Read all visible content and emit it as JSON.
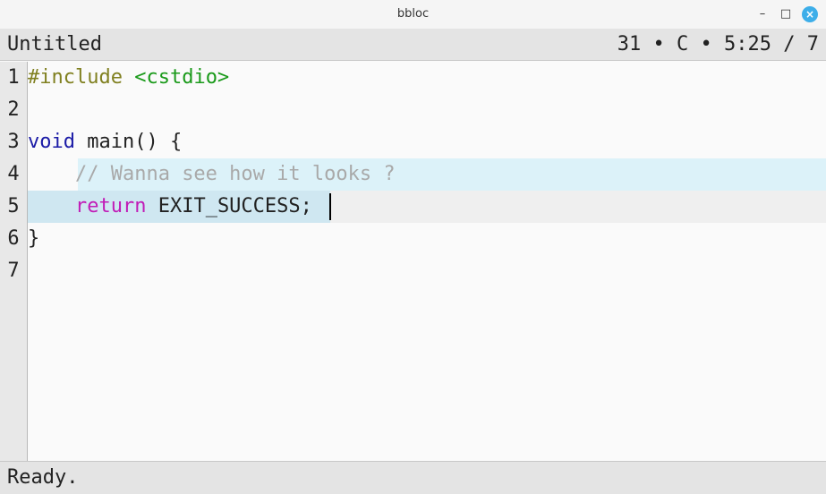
{
  "window": {
    "title": "bbloc",
    "minimize_glyph": "–",
    "maximize_glyph": "□",
    "close_glyph": "×"
  },
  "header": {
    "document_name": "Untitled",
    "info": {
      "char_count": "31",
      "separator1": " • ",
      "language": "C",
      "separator2": " • ",
      "cursor_position": "5:25",
      "separator3": " / ",
      "line_count": "7"
    }
  },
  "gutter": {
    "line_numbers": [
      "1",
      "2",
      "3",
      "4",
      "5",
      "6",
      "7"
    ]
  },
  "code": {
    "line1": {
      "preproc": "#include",
      "space": " ",
      "header": "<cstdio>"
    },
    "line3": {
      "keyword": "void",
      "rest": " main() {"
    },
    "line4": {
      "indent": "    ",
      "comment": "// Wanna see how it looks ?"
    },
    "line5": {
      "indent": "    ",
      "keyword": "return",
      "rest": " EXIT_SUCCESS;"
    },
    "line6": {
      "text": "}"
    }
  },
  "status": {
    "message": "Ready."
  },
  "colors": {
    "preprocessor": "#808020",
    "include_header": "#1a9a1a",
    "keyword_type": "#1a1aa6",
    "comment": "#a9a9a9",
    "keyword_return": "#c11cb7",
    "selection": "#dcf2f9",
    "close_button": "#3daee9"
  }
}
